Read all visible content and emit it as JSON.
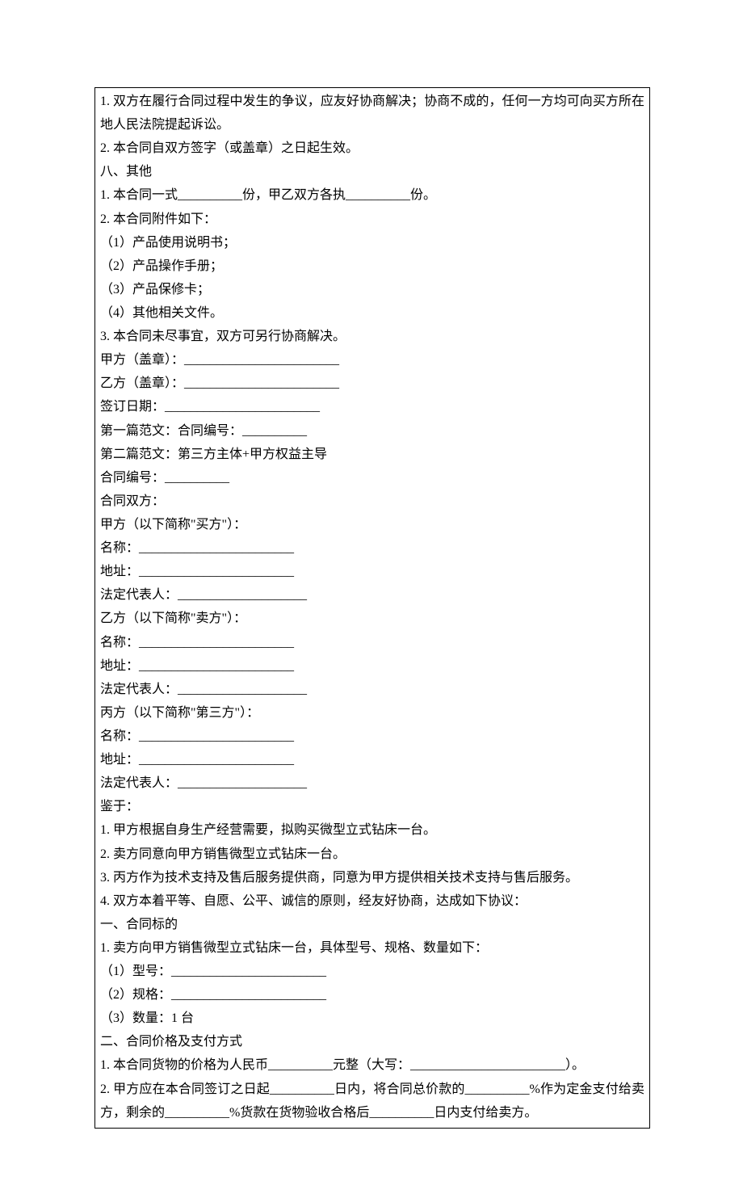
{
  "lines": [
    "1. 双方在履行合同过程中发生的争议，应友好协商解决；协商不成的，任何一方均可向买方所在地人民法院提起诉讼。",
    "2. 本合同自双方签字（或盖章）之日起生效。",
    "八、其他",
    "1. 本合同一式__________份，甲乙双方各执__________份。",
    "2. 本合同附件如下：",
    "（1）产品使用说明书；",
    "（2）产品操作手册；",
    "（3）产品保修卡；",
    "（4）其他相关文件。",
    "3. 本合同未尽事宜，双方可另行协商解决。",
    "甲方（盖章）：________________________",
    "乙方（盖章）：________________________",
    "签订日期：________________________",
    "第一篇范文：合同编号：__________",
    "第二篇范文：第三方主体+甲方权益主导",
    "合同编号：__________",
    "合同双方：",
    "甲方（以下简称\"买方\"）：",
    "名称：________________________",
    "地址：________________________",
    "法定代表人：____________________",
    "乙方（以下简称\"卖方\"）：",
    "名称：________________________",
    "地址：________________________",
    "法定代表人：____________________",
    "丙方（以下简称\"第三方\"）：",
    "名称：________________________",
    "地址：________________________",
    "法定代表人：____________________",
    "鉴于：",
    "1. 甲方根据自身生产经营需要，拟购买微型立式钻床一台。",
    "2. 卖方同意向甲方销售微型立式钻床一台。",
    "3. 丙方作为技术支持及售后服务提供商，同意为甲方提供相关技术支持与售后服务。",
    "4. 双方本着平等、自愿、公平、诚信的原则，经友好协商，达成如下协议：",
    "一、合同标的",
    "1. 卖方向甲方销售微型立式钻床一台，具体型号、规格、数量如下：",
    "（1）型号：________________________",
    "（2）规格：________________________",
    "（3）数量：1 台",
    "二、合同价格及支付方式",
    "1. 本合同货物的价格为人民币__________元整（大写：________________________）。",
    "2. 甲方应在本合同签订之日起__________日内，将合同总价款的__________%作为定金支付给卖方，剩余的__________%货款在货物验收合格后__________日内支付给卖方。"
  ]
}
